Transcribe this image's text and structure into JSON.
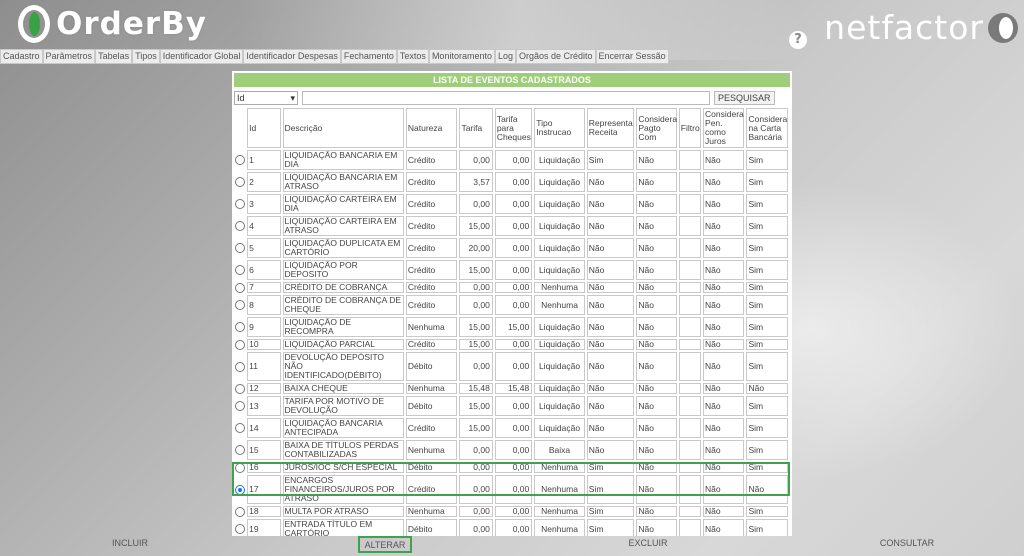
{
  "header": {
    "logo_text": "OrderBy",
    "brand_text": "netfactor",
    "help_label": "?"
  },
  "menu": [
    "Cadastro",
    "Parâmetros",
    "Tabelas",
    "Tipos",
    "Identificador Global",
    "Identificador Despesas",
    "Fechamento",
    "Textos",
    "Monitoramento",
    "Log",
    "Orgãos de Crédito",
    "Encerrar Sessão"
  ],
  "panel": {
    "title": "LISTA DE EVENTOS CADASTRADOS",
    "search_select_value": "Id",
    "search_input_value": "",
    "search_button": "PESQUISAR"
  },
  "table": {
    "headers": [
      "Id",
      "Descrição",
      "Natureza",
      "Tarifa",
      "Tarifa para Cheques",
      "Tipo Instrucao",
      "Representa Receita",
      "Considera Pagto Com",
      "Filtro",
      "Considera Pen. como Juros",
      "Considera na Carta Bancária"
    ],
    "selected_id": "17",
    "rows": [
      {
        "id": "1",
        "desc": "LIQUIDAÇÃO BANCARIA EM DIA",
        "nat": "Crédito",
        "tarifa": "0,00",
        "tcheq": "0,00",
        "tipo": "Liquidação",
        "rec": "Sim",
        "pagto": "Não",
        "filtro": "",
        "juros": "Não",
        "carta": "Sim"
      },
      {
        "id": "2",
        "desc": "LIQUIDAÇÃO BANCARIA EM ATRASO",
        "nat": "Crédito",
        "tarifa": "3,57",
        "tcheq": "0,00",
        "tipo": "Liquidação",
        "rec": "Não",
        "pagto": "Não",
        "filtro": "",
        "juros": "Não",
        "carta": "Sim"
      },
      {
        "id": "3",
        "desc": "LIQUIDAÇÃO CARTEIRA EM DIA",
        "nat": "Crédito",
        "tarifa": "0,00",
        "tcheq": "0,00",
        "tipo": "Liquidação",
        "rec": "Não",
        "pagto": "Não",
        "filtro": "",
        "juros": "Não",
        "carta": "Sim"
      },
      {
        "id": "4",
        "desc": "LIQUIDAÇÃO CARTEIRA EM ATRASO",
        "nat": "Crédito",
        "tarifa": "15,00",
        "tcheq": "0,00",
        "tipo": "Liquidação",
        "rec": "Não",
        "pagto": "Não",
        "filtro": "",
        "juros": "Não",
        "carta": "Sim"
      },
      {
        "id": "5",
        "desc": "LIQUIDAÇÃO DUPLICATA EM CARTÓRIO",
        "nat": "Crédito",
        "tarifa": "20,00",
        "tcheq": "0,00",
        "tipo": "Liquidação",
        "rec": "Não",
        "pagto": "Não",
        "filtro": "",
        "juros": "Não",
        "carta": "Sim"
      },
      {
        "id": "6",
        "desc": "LIQUIDAÇÃO POR DEPOSITO",
        "nat": "Crédito",
        "tarifa": "15,00",
        "tcheq": "0,00",
        "tipo": "Liquidação",
        "rec": "Não",
        "pagto": "Não",
        "filtro": "",
        "juros": "Não",
        "carta": "Sim"
      },
      {
        "id": "7",
        "desc": "CRÉDITO DE COBRANÇA",
        "nat": "Crédito",
        "tarifa": "0,00",
        "tcheq": "0,00",
        "tipo": "Nenhuma",
        "rec": "Não",
        "pagto": "Não",
        "filtro": "",
        "juros": "Não",
        "carta": "Sim"
      },
      {
        "id": "8",
        "desc": "CRÉDITO DE COBRANÇA DE CHEQUE",
        "nat": "Crédito",
        "tarifa": "0,00",
        "tcheq": "0,00",
        "tipo": "Nenhuma",
        "rec": "Não",
        "pagto": "Não",
        "filtro": "",
        "juros": "Não",
        "carta": "Sim"
      },
      {
        "id": "9",
        "desc": "LIQUIDAÇÃO DE RECOMPRA",
        "nat": "Nenhuma",
        "tarifa": "15,00",
        "tcheq": "15,00",
        "tipo": "Liquidação",
        "rec": "Não",
        "pagto": "Não",
        "filtro": "",
        "juros": "Não",
        "carta": "Sim"
      },
      {
        "id": "10",
        "desc": "LIQUIDAÇÃO PARCIAL",
        "nat": "Crédito",
        "tarifa": "15,00",
        "tcheq": "0,00",
        "tipo": "Liquidação",
        "rec": "Não",
        "pagto": "Não",
        "filtro": "",
        "juros": "Não",
        "carta": "Sim"
      },
      {
        "id": "11",
        "desc": "DEVOLUÇÃO DEPÓSITO NÃO IDENTIFICADO(DÉBITO)",
        "nat": "Débito",
        "tarifa": "0,00",
        "tcheq": "0,00",
        "tipo": "Liquidação",
        "rec": "Não",
        "pagto": "Não",
        "filtro": "",
        "juros": "Não",
        "carta": "Sim"
      },
      {
        "id": "12",
        "desc": "BAIXA CHEQUE",
        "nat": "Nenhuma",
        "tarifa": "15,48",
        "tcheq": "15,48",
        "tipo": "Liquidação",
        "rec": "Não",
        "pagto": "Não",
        "filtro": "",
        "juros": "Não",
        "carta": "Não"
      },
      {
        "id": "13",
        "desc": "TARIFA POR MOTIVO DE DEVOLUÇÃO",
        "nat": "Débito",
        "tarifa": "15,00",
        "tcheq": "0,00",
        "tipo": "Liquidação",
        "rec": "Não",
        "pagto": "Não",
        "filtro": "",
        "juros": "Não",
        "carta": "Sim"
      },
      {
        "id": "14",
        "desc": "LIQUIDAÇÃO BANCARIA ANTECIPADA",
        "nat": "Crédito",
        "tarifa": "15,00",
        "tcheq": "0,00",
        "tipo": "Liquidação",
        "rec": "Não",
        "pagto": "Não",
        "filtro": "",
        "juros": "Não",
        "carta": "Sim"
      },
      {
        "id": "15",
        "desc": "BAIXA DE TÍTULOS PERDAS CONTABILIZADAS",
        "nat": "Nenhuma",
        "tarifa": "0,00",
        "tcheq": "0,00",
        "tipo": "Baixa",
        "rec": "Não",
        "pagto": "Não",
        "filtro": "",
        "juros": "Não",
        "carta": "Sim"
      },
      {
        "id": "16",
        "desc": "JUROS/IOC S/CH ESPECIAL",
        "nat": "Débito",
        "tarifa": "0,00",
        "tcheq": "0,00",
        "tipo": "Nenhuma",
        "rec": "Sim",
        "pagto": "Não",
        "filtro": "",
        "juros": "Não",
        "carta": "Sim"
      },
      {
        "id": "17",
        "desc": "ENCARGOS FINANCEIROS/JUROS POR ATRASO",
        "nat": "Crédito",
        "tarifa": "0,00",
        "tcheq": "0,00",
        "tipo": "Nenhuma",
        "rec": "Sim",
        "pagto": "Não",
        "filtro": "",
        "juros": "Não",
        "carta": "Não"
      },
      {
        "id": "18",
        "desc": "MULTA POR ATRASO",
        "nat": "Nenhuma",
        "tarifa": "0,00",
        "tcheq": "0,00",
        "tipo": "Nenhuma",
        "rec": "Sim",
        "pagto": "Não",
        "filtro": "",
        "juros": "Não",
        "carta": "Sim"
      },
      {
        "id": "19",
        "desc": "ENTRADA TÍTULO EM CARTÓRIO",
        "nat": "Débito",
        "tarifa": "0,00",
        "tcheq": "0,00",
        "tipo": "Nenhuma",
        "rec": "Sim",
        "pagto": "Não",
        "filtro": "",
        "juros": "Não",
        "carta": "Sim"
      }
    ]
  },
  "bottom": {
    "incluir": "INCLUIR",
    "alterar": "ALTERAR",
    "excluir": "EXCLUIR",
    "consultar": "CONSULTAR"
  },
  "colors": {
    "accent_green": "#3fa34d",
    "title_bar": "#9fce7a",
    "radio_selected": "#1a73e8"
  }
}
